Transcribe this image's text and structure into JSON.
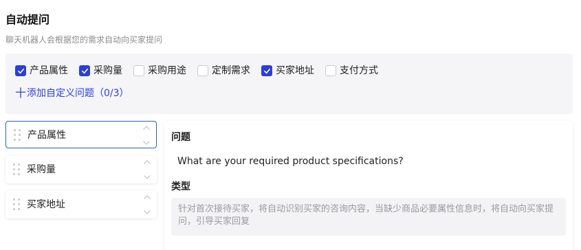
{
  "header": {
    "title": "自动提问",
    "subtitle": "聊天机器人会根据您的需求自动向买家提问"
  },
  "options": [
    {
      "label": "产品属性",
      "checked": true
    },
    {
      "label": "采购量",
      "checked": true
    },
    {
      "label": "采购用途",
      "checked": false
    },
    {
      "label": "定制需求",
      "checked": false
    },
    {
      "label": "买家地址",
      "checked": true
    },
    {
      "label": "支付方式",
      "checked": false
    }
  ],
  "add_custom": {
    "icon": "plus-icon",
    "plus": "十",
    "label": "添加自定义问题（0/3）"
  },
  "question_list": [
    {
      "label": "产品属性",
      "active": true
    },
    {
      "label": "采购量",
      "active": false
    },
    {
      "label": "买家地址",
      "active": false
    }
  ],
  "detail": {
    "question_label": "问题",
    "question_value": "What are your required product specifications?",
    "type_label": "类型",
    "type_description": "针对首次接待买家，将自动识别买家的咨询内容，当缺少商品必要属性信息时，将自动向买家提问，引导买家回复"
  },
  "colors": {
    "accent": "#2c3fd4",
    "active_border": "#2c5fae",
    "panel_bg": "#f5f5f7"
  }
}
